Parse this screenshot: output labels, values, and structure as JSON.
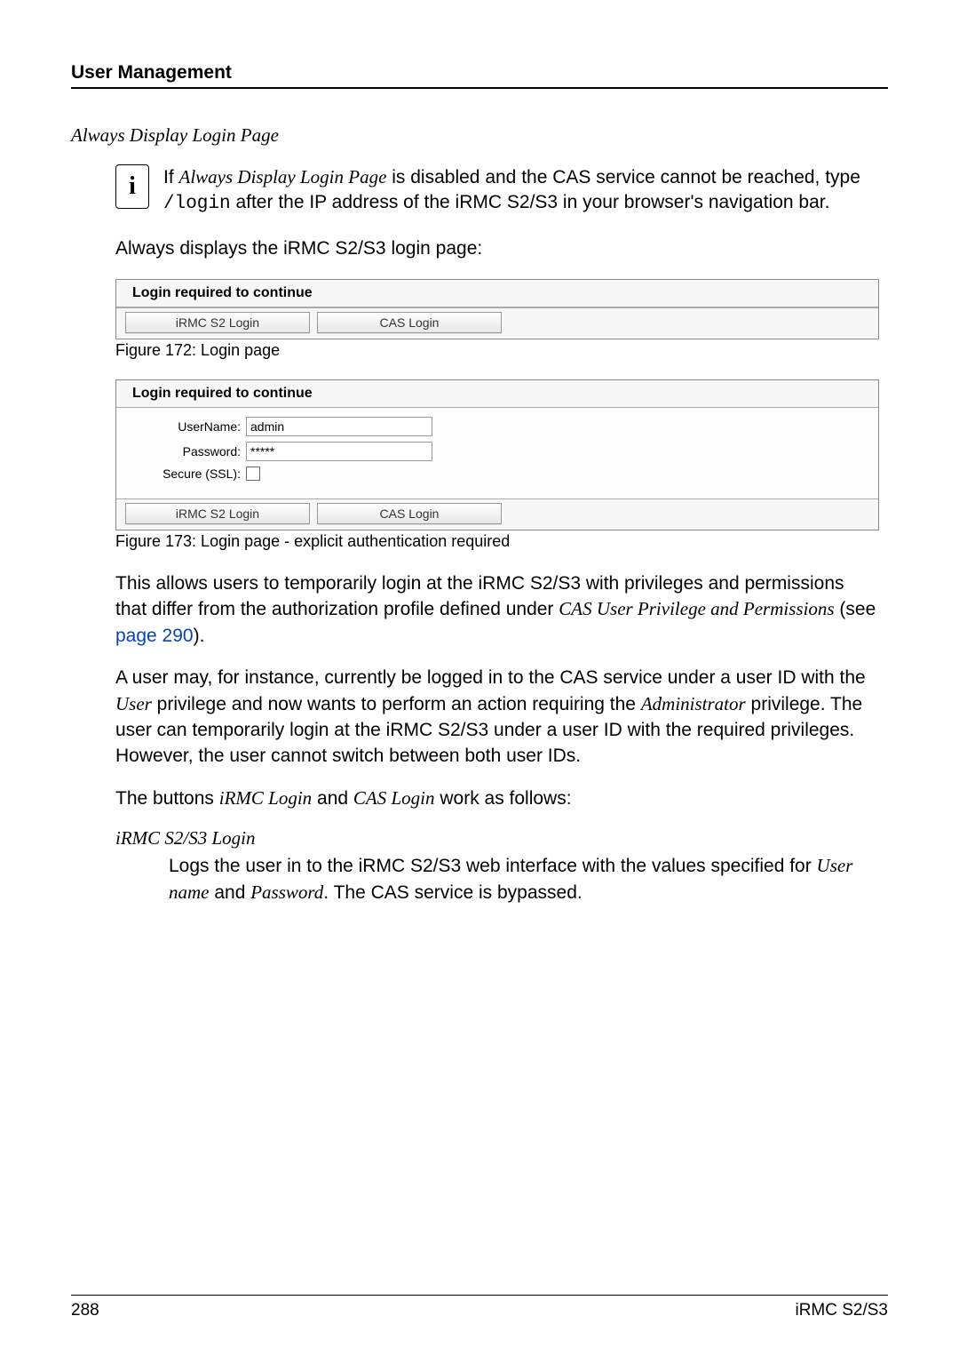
{
  "header": {
    "title": "User Management"
  },
  "subtitle": "Always Display Login Page",
  "info": {
    "prefix": "If ",
    "italic1": "Always Display Login Page",
    "mid1": " is disabled and the CAS service cannot be reached, type ",
    "mono": "/login",
    "tail": " after the IP address of the iRMC S2/S3 in your browser's navigation bar."
  },
  "para1": "Always displays the iRMC S2/S3 login page:",
  "fig172": {
    "panel_title": "Login required to continue",
    "btn1": "iRMC S2 Login",
    "btn2": "CAS Login",
    "caption": "Figure 172: Login page"
  },
  "fig173": {
    "panel_title": "Login required to continue",
    "label_user": "UserName:",
    "value_user": "admin",
    "label_pass": "Password:",
    "value_pass": "*****",
    "label_ssl": "Secure (SSL):",
    "btn1": "iRMC S2 Login",
    "btn2": "CAS Login",
    "caption": "Figure 173: Login page - explicit authentication required"
  },
  "para2": {
    "l1": "This allows users to temporarily login at the iRMC S2/S3 with privileges and permissions that differ from the authorization profile defined under ",
    "italic": "CAS User Privilege and Permissions",
    "see": " (see ",
    "link": "page 290",
    "close": ")."
  },
  "para3": {
    "l1": "A user may, for instance, currently be logged in to the CAS service under a user ID with the ",
    "it1": "User",
    "l2": " privilege and now wants to perform an action requiring the ",
    "it2": "Administrator",
    "l3": " privilege. The user can temporarily login at the iRMC S2/S3 under a user ID with the required privileges. However, the user cannot switch between both user IDs."
  },
  "para4": {
    "l1": "The buttons ",
    "it1": "iRMC Login",
    "l2": " and ",
    "it2": "CAS Login",
    "l3": " work as follows:"
  },
  "def": {
    "term": "iRMC S2/S3 Login",
    "b1": "Logs the user in to the iRMC S2/S3 web interface with the values specified for ",
    "it1": "User name",
    "b2": " and ",
    "it2": "Password",
    "b3": ".  The CAS service is bypassed."
  },
  "footer": {
    "page": "288",
    "doc": "iRMC S2/S3"
  }
}
